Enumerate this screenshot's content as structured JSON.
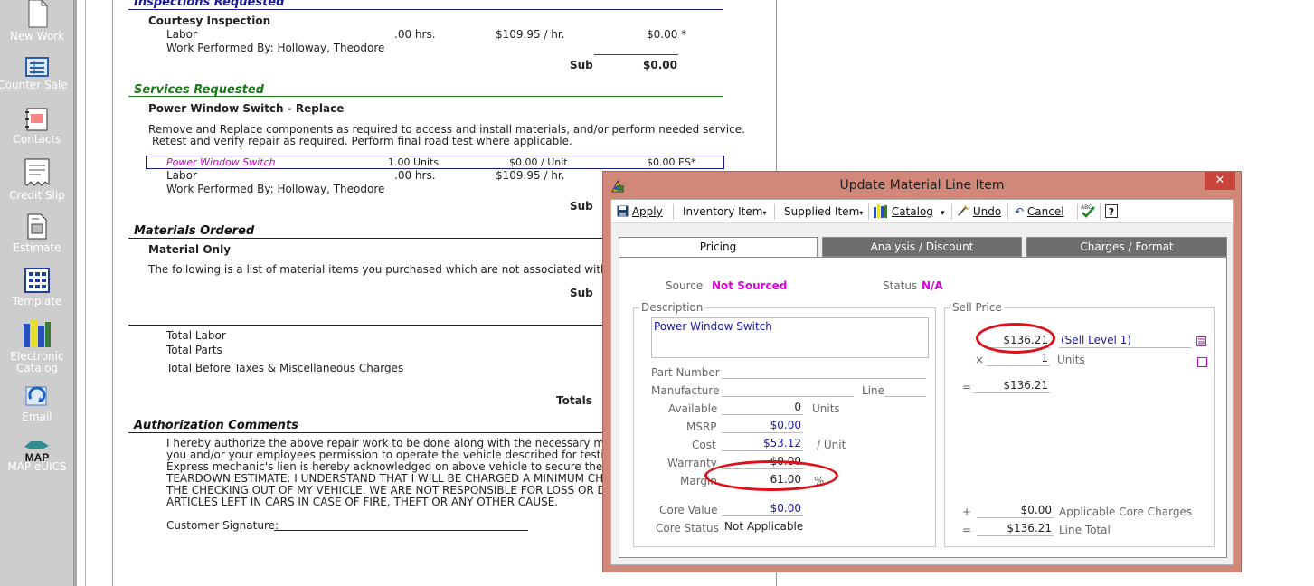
{
  "sidebar": {
    "items": [
      {
        "label": "New Work",
        "icon": "new-work-icon"
      },
      {
        "label": "Counter Sale",
        "icon": "counter-sale-icon"
      },
      {
        "label": "Contacts",
        "icon": "contacts-icon"
      },
      {
        "label": "Credit Slip",
        "icon": "credit-slip-icon"
      },
      {
        "label": "Estimate",
        "icon": "estimate-icon"
      },
      {
        "label": "Template",
        "icon": "template-icon"
      },
      {
        "label": "Electronic",
        "label2": "Catalog",
        "icon": "electronic-catalog-icon"
      },
      {
        "label": "Email",
        "icon": "email-icon"
      },
      {
        "label": "MAP eUICS",
        "icon_text": "MAP",
        "icon": "map-euics-icon"
      }
    ]
  },
  "document": {
    "inspections": {
      "header": "Inspections Requested",
      "title": "Courtesy Inspection",
      "labor_label": "Labor",
      "labor_hrs": ".00 hrs.",
      "labor_rate": "$109.95 / hr.",
      "labor_amount": "$0.00 *",
      "performed_by": "Work Performed By: Holloway, Theodore",
      "sub_label": "Sub",
      "sub_amount": "$0.00"
    },
    "services": {
      "header": "Services Requested",
      "title": "Power Window Switch - Replace",
      "description_line1": "Remove and Replace components as required to access and install materials, and/or perform needed service.",
      "description_line2": "Retest and verify repair as required.  Perform final road test where applicable.",
      "item_name": "Power Window Switch",
      "item_qty": "1.00 Units",
      "item_rate": "$0.00 / Unit",
      "item_amount": "$0.00 ES*",
      "labor_label": "Labor",
      "labor_hrs": ".00 hrs.",
      "labor_rate": "$109.95 / hr.",
      "performed_by": "Work Performed By: Holloway, Theodore",
      "sub_label": "Sub"
    },
    "materials": {
      "header": "Materials Ordered",
      "title": "Material Only",
      "description": "The following is a list of material items you purchased which are not associated with ser",
      "sub_label": "Sub"
    },
    "totals": {
      "total_labor": "Total Labor",
      "total_parts": "Total Parts",
      "total_before": "Total Before Taxes & Miscellaneous Charges",
      "totals_label": "Totals"
    },
    "authorization": {
      "header": "Authorization Comments",
      "lines": [
        "I hereby authorize the above repair work to be done along with the necessary mater",
        "you and/or your employees permission to operate the vehicle described for testing a",
        "Express mechanic's lien is hereby acknowledged on above vehicle to secure the amo",
        "TEARDOWN ESTIMATE: I UNDERSTAND THAT I WILL BE CHARGED A MINIMUM CHAR",
        "THE CHECKING OUT OF MY VEHICLE. WE ARE NOT RESPONSIBLE FOR LOSS OR DAM",
        "ARTICLES LEFT IN CARS IN CASE OF FIRE, THEFT OR ANY OTHER CAUSE."
      ],
      "signature_label": "Customer Signature:"
    }
  },
  "dialog": {
    "title": "Update Material Line Item",
    "close": "✕",
    "toolbar": {
      "apply": "Apply",
      "inventory_item": "Inventory Item",
      "supplied_item": "Supplied Item",
      "catalog": "Catalog",
      "undo": "Undo",
      "cancel": "Cancel"
    },
    "tabs": [
      "Pricing",
      "Analysis / Discount",
      "Charges / Format"
    ],
    "pricing": {
      "source_label": "Source",
      "source_value": "Not Sourced",
      "status_label": "Status",
      "status_value": "N/A",
      "description_legend": "Description",
      "description_value": "Power Window Switch",
      "part_number_label": "Part Number",
      "part_number_value": "",
      "manufacture_label": "Manufacture",
      "manufacture_value": "",
      "line_label": "Line",
      "line_value": "",
      "available_label": "Available",
      "available_value": "0",
      "available_unit": "Units",
      "msrp_label": "MSRP",
      "msrp_value": "$0.00",
      "cost_label": "Cost",
      "cost_value": "$53.12",
      "cost_unit": "/ Unit",
      "warranty_label": "Warranty",
      "warranty_value": "$0.00",
      "margin_label": "Margin",
      "margin_value": "61.00",
      "margin_unit": "%",
      "core_value_label": "Core Value",
      "core_value_value": "$0.00",
      "core_status_label": "Core Status",
      "core_status_value": "Not Applicable",
      "sell_price_legend": "Sell Price",
      "sell_price_value": "$136.21",
      "sell_level": "(Sell Level 1)",
      "times_symbol": "×",
      "qty_value": "1",
      "qty_unit": "Units",
      "equals_symbol": "=",
      "extended_value": "$136.21",
      "plus_symbol": "+",
      "core_charges_value": "$0.00",
      "core_charges_label": "Applicable Core Charges",
      "line_total_value": "$136.21",
      "line_total_label": "Line Total"
    },
    "colors": {
      "title_bar": "#d18878",
      "highlight_oval": "#e0101a",
      "value_blue": "#1a1aa8",
      "source_pink": "#dd00dd"
    }
  }
}
